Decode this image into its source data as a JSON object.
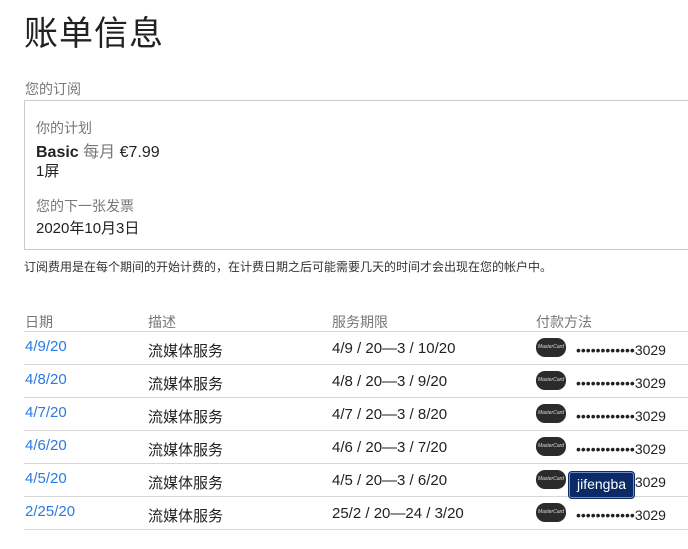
{
  "page": {
    "title": "账单信息"
  },
  "subscription": {
    "section_label": "您的订阅",
    "plan_caption": "你的计划",
    "plan_name": "Basic",
    "billing_period": "每月",
    "price": "€7.99",
    "screens": "1屏",
    "next_bill_caption": "您的下一张发票",
    "next_bill_date": "2020年10月3日"
  },
  "note": "订阅费用是在每个期间的开始计费的，在计费日期之后可能需要几天的时间才会出现在您的帐户中。",
  "history": {
    "headers": {
      "date": "日期",
      "description": "描述",
      "period": "服务期限",
      "payment": "付款方法"
    },
    "rows": [
      {
        "date": "4/9/20",
        "description": "流媒体服务",
        "period": "4/9 / 20—3 / 10/20",
        "card_icon": "MasterCard",
        "card": "••••••••••••3029"
      },
      {
        "date": "4/8/20",
        "description": "流媒体服务",
        "period": "4/8 / 20—3 / 9/20",
        "card_icon": "MasterCard",
        "card": "••••••••••••3029"
      },
      {
        "date": "4/7/20",
        "description": "流媒体服务",
        "period": "4/7 / 20—3 / 8/20",
        "card_icon": "MasterCard",
        "card": "••••••••••••3029"
      },
      {
        "date": "4/6/20",
        "description": "流媒体服务",
        "period": "4/6 / 20—3 / 7/20",
        "card_icon": "MasterCard",
        "card": "••••••••••••3029"
      },
      {
        "date": "4/5/20",
        "description": "流媒体服务",
        "period": "4/5 / 20—3 / 6/20",
        "card_icon": "MasterCard",
        "card": "••••••••••••3029"
      },
      {
        "date": "2/25/20",
        "description": "流媒体服务",
        "period": "25/2 / 20—24 / 3/20",
        "card_icon": "MasterCard",
        "card": "••••••••••••3029"
      }
    ]
  },
  "tooltip": "jifengba",
  "colors": {
    "link": "#2a7ae2",
    "tooltip_bg": "#0b2a66",
    "muted_text": "#777777"
  }
}
